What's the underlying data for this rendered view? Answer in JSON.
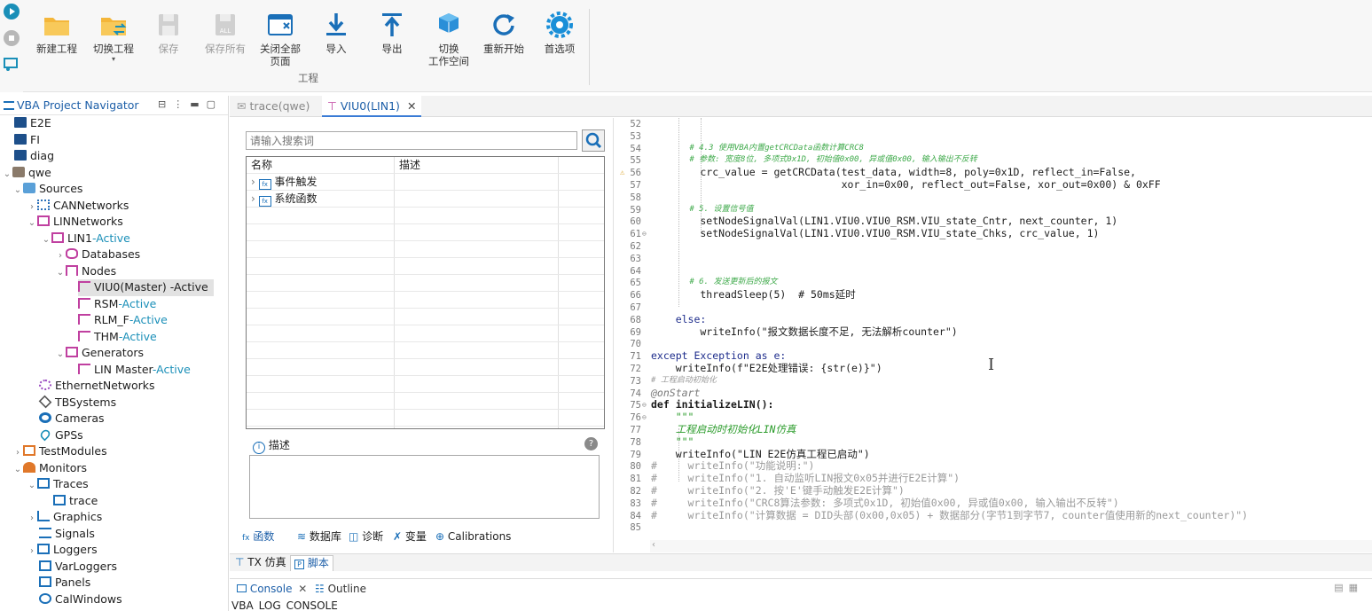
{
  "toolbar": {
    "new_project": "新建工程",
    "switch_project": "切换工程",
    "save": "保存",
    "save_all": "保存所有",
    "close_all_pages": "关闭全部\n页面",
    "import": "导入",
    "export": "导出",
    "switch_workspace": "切换\n工作空间",
    "restart": "重新开始",
    "preferences": "首选项",
    "group_label": "工程"
  },
  "navigator": {
    "title": "VBA Project Navigator",
    "items": [
      {
        "label": "E2E",
        "suffix": ""
      },
      {
        "label": "FI",
        "suffix": ""
      },
      {
        "label": "diag",
        "suffix": ""
      },
      {
        "label": "qwe",
        "suffix": ""
      },
      {
        "label": "Sources",
        "suffix": ""
      },
      {
        "label": "CANNetworks",
        "suffix": ""
      },
      {
        "label": "LINNetworks",
        "suffix": ""
      },
      {
        "label": "LIN1",
        "suffix": "-Active"
      },
      {
        "label": "Databases",
        "suffix": ""
      },
      {
        "label": "Nodes",
        "suffix": ""
      },
      {
        "label": "VIU0(Master) -Active",
        "suffix": ""
      },
      {
        "label": "RSM",
        "suffix": "-Active"
      },
      {
        "label": "RLM_F",
        "suffix": "-Active"
      },
      {
        "label": "THM",
        "suffix": "-Active"
      },
      {
        "label": "Generators",
        "suffix": ""
      },
      {
        "label": "LIN Master",
        "suffix": "-Active"
      },
      {
        "label": "EthernetNetworks",
        "suffix": ""
      },
      {
        "label": "TBSystems",
        "suffix": ""
      },
      {
        "label": "Cameras",
        "suffix": ""
      },
      {
        "label": "GPSs",
        "suffix": ""
      },
      {
        "label": "TestModules",
        "suffix": ""
      },
      {
        "label": "Monitors",
        "suffix": ""
      },
      {
        "label": "Traces",
        "suffix": ""
      },
      {
        "label": "trace",
        "suffix": ""
      },
      {
        "label": "Graphics",
        "suffix": ""
      },
      {
        "label": "Signals",
        "suffix": ""
      },
      {
        "label": "Loggers",
        "suffix": ""
      },
      {
        "label": "VarLoggers",
        "suffix": ""
      },
      {
        "label": "Panels",
        "suffix": ""
      },
      {
        "label": "CalWindows",
        "suffix": ""
      }
    ]
  },
  "editor_tabs": [
    {
      "label": "trace(qwe)"
    },
    {
      "label": "VIU0(LIN1)"
    }
  ],
  "function_panel": {
    "search_placeholder": "请输入搜索词",
    "col_name": "名称",
    "col_desc": "描述",
    "rows": [
      "事件触发",
      "系统函数"
    ],
    "desc_label": "描述",
    "tabs": [
      "函数",
      "数据库",
      "诊断",
      "变量",
      "Calibrations"
    ]
  },
  "code": {
    "lines": [
      {
        "n": "52",
        "t": ""
      },
      {
        "n": "53",
        "t": ""
      },
      {
        "n": "54",
        "t": "        # 4.3 使用VBA内置getCRCData函数计算CRC8"
      },
      {
        "n": "55",
        "t": "        # 参数: 宽度8位, 多项式0x1D, 初始值0x00, 异或值0x00, 输入输出不反转"
      },
      {
        "n": "56",
        "t": "        crc_value = getCRCData(test_data, width=8, poly=0x1D, reflect_in=False,"
      },
      {
        "n": "57",
        "t": "                               xor_in=0x00, reflect_out=False, xor_out=0x00) & 0xFF"
      },
      {
        "n": "58",
        "t": ""
      },
      {
        "n": "59",
        "t": "        # 5. 设置信号值"
      },
      {
        "n": "60",
        "t": "        setNodeSignalVal(LIN1.VIU0.VIU0_RSM.VIU_state_Cntr, next_counter, 1)"
      },
      {
        "n": "61",
        "t": "        setNodeSignalVal(LIN1.VIU0.VIU0_RSM.VIU_state_Chks, crc_value, 1)"
      },
      {
        "n": "62",
        "t": ""
      },
      {
        "n": "63",
        "t": ""
      },
      {
        "n": "64",
        "t": ""
      },
      {
        "n": "65",
        "t": "        # 6. 发送更新后的报文"
      },
      {
        "n": "66",
        "t": "        threadSleep(5)  # 50ms延时"
      },
      {
        "n": "67",
        "t": ""
      },
      {
        "n": "68",
        "t": "    else:"
      },
      {
        "n": "69",
        "t": "        writeInfo(\"报文数据长度不足, 无法解析counter\")"
      },
      {
        "n": "70",
        "t": ""
      },
      {
        "n": "71",
        "t": "except Exception as e:"
      },
      {
        "n": "72",
        "t": "    writeInfo(f\"E2E处理错误: {str(e)}\")"
      },
      {
        "n": "73",
        "t": "# 工程启动初始化"
      },
      {
        "n": "74",
        "t": "@onStart"
      },
      {
        "n": "75",
        "t": "def initializeLIN():"
      },
      {
        "n": "76",
        "t": "    \"\"\""
      },
      {
        "n": "77",
        "t": "    工程启动时初始化LIN仿真"
      },
      {
        "n": "78",
        "t": "    \"\"\""
      },
      {
        "n": "79",
        "t": "    writeInfo(\"LIN E2E仿真工程已启动\")"
      },
      {
        "n": "80",
        "t": "#     writeInfo(\"功能说明:\")"
      },
      {
        "n": "81",
        "t": "#     writeInfo(\"1. 自动监听LIN报文0x05并进行E2E计算\")"
      },
      {
        "n": "82",
        "t": "#     writeInfo(\"2. 按'E'键手动触发E2E计算\")"
      },
      {
        "n": "83",
        "t": "#     writeInfo(\"CRC8算法参数: 多项式0x1D, 初始值0x00, 异或值0x00, 输入输出不反转\")"
      },
      {
        "n": "84",
        "t": "#     writeInfo(\"计算数据 = DID头部(0x00,0x05) + 数据部分(字节1到字节7, counter值使用新的next_counter)\")"
      },
      {
        "n": "85",
        "t": ""
      }
    ]
  },
  "bottom_tabs": [
    {
      "label": "TX 仿真"
    },
    {
      "label": "脚本"
    }
  ],
  "console": {
    "tab_console": "Console",
    "tab_outline": "Outline",
    "text": "VBA_LOG_CONSOLE"
  }
}
